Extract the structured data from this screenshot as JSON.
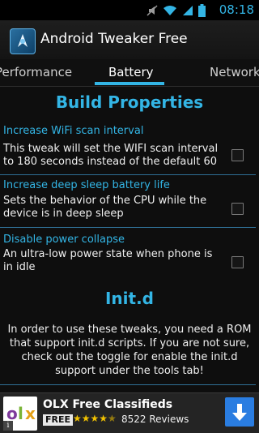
{
  "status_bar": {
    "time": "08:18"
  },
  "app_bar": {
    "title": "Android Tweaker Free"
  },
  "tabs": {
    "previous": "Performance",
    "current": "Battery",
    "next": "Network"
  },
  "sections": {
    "build_properties": {
      "title": "Build Properties"
    },
    "initd": {
      "title": "Init.d",
      "description": "In order to use these tweaks, you need a ROM that support init.d scripts. If you are not sure, check out the toggle for enable the init.d support under the tools tab!"
    }
  },
  "tweaks": [
    {
      "title": "Increase WiFi scan interval",
      "description": "This tweak will set the WIFI scan interval to 180 seconds instead of the default 60",
      "checked": false
    },
    {
      "title": "Increase deep sleep battery life",
      "description": "Sets the behavior of the CPU while the device is in deep sleep",
      "checked": false
    },
    {
      "title": "Disable power collapse",
      "description": "An ultra-low power state when phone is in idle",
      "checked": false
    }
  ],
  "ad": {
    "title": "OLX Free Classifieds",
    "free_label": "FREE",
    "stars": "★★★★",
    "half_star": "★",
    "reviews": "8522 Reviews",
    "logo_o": "o",
    "logo_l": "l",
    "logo_x": "x",
    "info": "i"
  },
  "colors": {
    "accent": "#33b5e5",
    "background": "#0e0e0e",
    "divider": "#2f6f95"
  }
}
